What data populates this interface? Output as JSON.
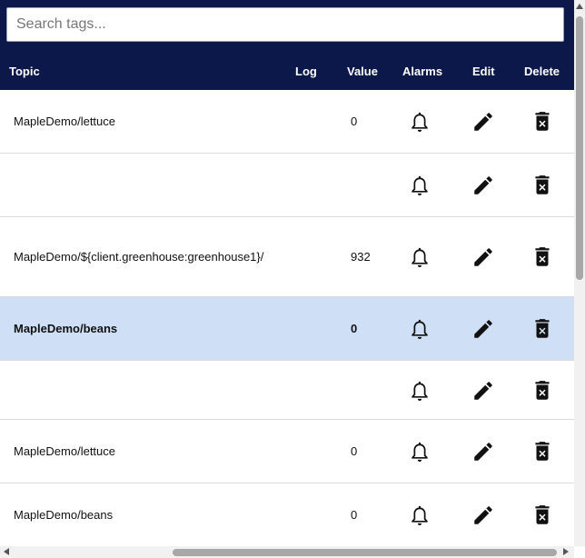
{
  "search": {
    "placeholder": "Search tags..."
  },
  "columns": {
    "topic": "Topic",
    "log": "Log",
    "value": "Value",
    "alarms": "Alarms",
    "edit": "Edit",
    "delete": "Delete"
  },
  "rows": [
    {
      "topic": "MapleDemo/lettuce",
      "value": "0",
      "selected": false
    },
    {
      "topic": "",
      "value": "",
      "selected": false
    },
    {
      "topic": "MapleDemo/${client.greenhouse:greenhouse1}/",
      "value": "932",
      "selected": false
    },
    {
      "topic": "MapleDemo/beans",
      "value": "0",
      "selected": true
    },
    {
      "topic": "",
      "value": "",
      "selected": false
    },
    {
      "topic": "MapleDemo/lettuce",
      "value": "0",
      "selected": false
    },
    {
      "topic": "MapleDemo/beans",
      "value": "0",
      "selected": false
    }
  ],
  "icons": {
    "alarm": "bell-icon",
    "edit": "pencil-icon",
    "delete": "trash-icon"
  }
}
